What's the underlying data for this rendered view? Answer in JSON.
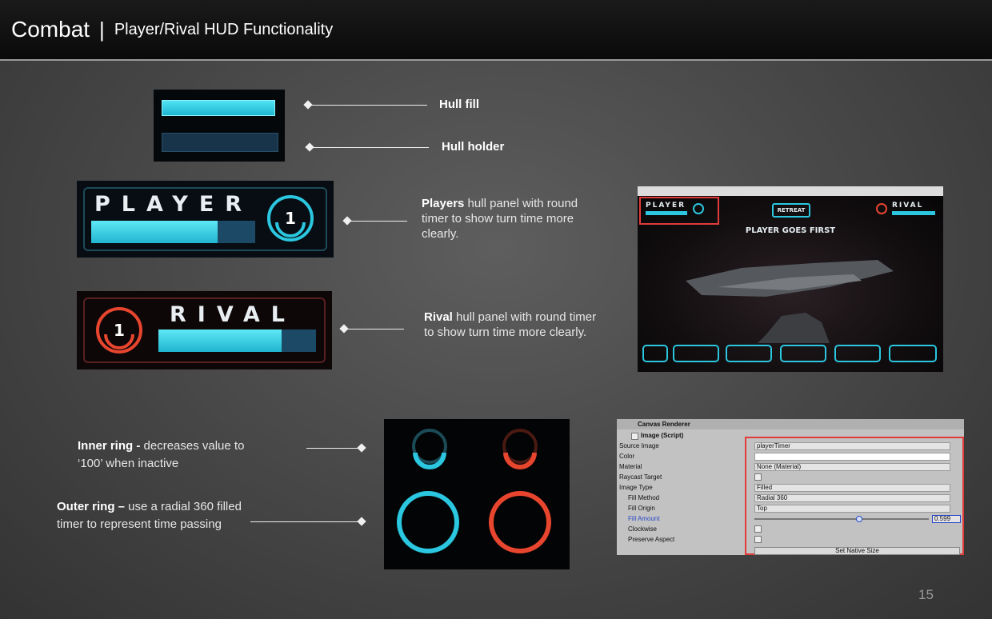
{
  "header": {
    "title": "Combat",
    "separator": "|",
    "subtitle": "Player/Rival HUD Functionality"
  },
  "labels": {
    "hull_fill": "Hull fill",
    "hull_holder": "Hull holder",
    "players_bold": "Players",
    "players_text": " hull panel with round timer to show turn time more clearly.",
    "rival_bold": "Rival",
    "rival_text": " hull panel with round timer to show turn time more clearly.",
    "inner_bold": "Inner ring -",
    "inner_text": " decreases value to ‘100’ when inactive",
    "outer_bold": "Outer ring –",
    "outer_text": " use a radial 360 filled timer to represent time passing"
  },
  "player_panel": {
    "name": "PLAYER",
    "timer": "1",
    "hull_level": 0.77
  },
  "rival_panel": {
    "name": "RIVAL",
    "timer": "1",
    "hull_level": 0.78
  },
  "game": {
    "player_tag": "PLAYER",
    "rival_tag": "RIVAL",
    "retreat": "RETREAT",
    "banner": "PLAYER GOES FIRST"
  },
  "inspector": {
    "component_title": "Canvas Renderer",
    "script_title": "Image (Script)",
    "rows": [
      {
        "label": "Source Image",
        "value": "playerTimer"
      },
      {
        "label": "Color",
        "value": ""
      },
      {
        "label": "Material",
        "value": "None (Material)"
      },
      {
        "label": "Raycast Target",
        "value": ""
      },
      {
        "label": "Image Type",
        "value": "Filled"
      },
      {
        "label": "Fill Method",
        "value": "Radial 360"
      },
      {
        "label": "Fill Origin",
        "value": "Top"
      },
      {
        "label": "Fill Amount",
        "value": "0.599"
      },
      {
        "label": "Clockwise",
        "value": ""
      },
      {
        "label": "Preserve Aspect",
        "value": ""
      }
    ],
    "fill_amount": 0.599,
    "native_button": "Set Native Size"
  },
  "page_number": "15",
  "colors": {
    "cyan": "#2bc6df",
    "red": "#e8452f",
    "highlight_red": "#e23b3b"
  }
}
